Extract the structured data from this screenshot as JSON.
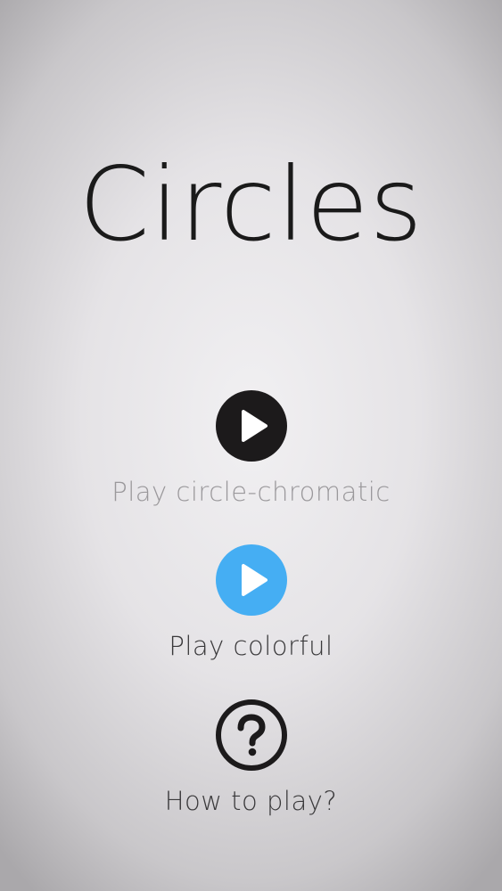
{
  "app": {
    "title": "Circles"
  },
  "menu": {
    "items": [
      {
        "label": "Play circle-chromatic",
        "icon": "play-icon",
        "circle_color": "#1c1a1b",
        "label_color": "#9a989b"
      },
      {
        "label": "Play colorful",
        "icon": "play-icon",
        "circle_color": "#45aef3",
        "label_color": "#3a393b"
      },
      {
        "label": "How to play?",
        "icon": "question-mark-icon",
        "circle_color": "#1c1a1b",
        "label_color": "#3a393b"
      }
    ]
  },
  "colors": {
    "background_center": "#f1f0f2",
    "background_edge": "#aaa8ab",
    "title_text": "#1a1a1a"
  }
}
